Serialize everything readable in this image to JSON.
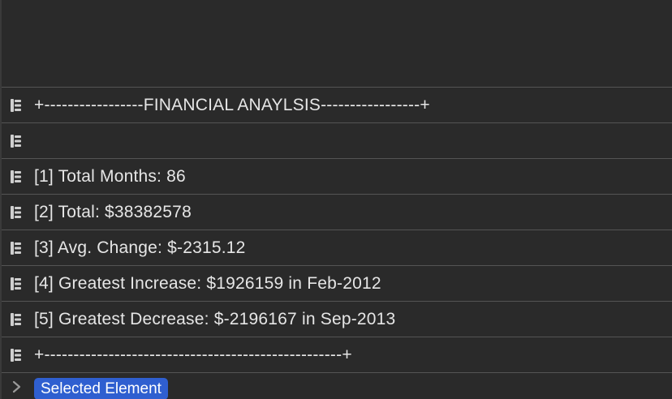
{
  "console": {
    "rows": [
      {
        "text": "+-----------------FINANCIAL ANAYLSIS-----------------+",
        "icon": "log-entry-icon"
      },
      {
        "text": "",
        "icon": "log-entry-icon"
      },
      {
        "text": "[1] Total Months: 86",
        "icon": "log-entry-icon"
      },
      {
        "text": "[2] Total: $38382578",
        "icon": "log-entry-icon"
      },
      {
        "text": "[3] Avg. Change: $-2315.12",
        "icon": "log-entry-icon"
      },
      {
        "text": "[4] Greatest Increase: $1926159 in Feb-2012",
        "icon": "log-entry-icon"
      },
      {
        "text": "[5] Greatest Decrease: $-2196167 in Sep-2013",
        "icon": "log-entry-icon"
      },
      {
        "text": "+---------------------------------------------------+",
        "icon": "log-entry-icon"
      }
    ],
    "prompt": {
      "badge_label": "Selected Element",
      "icon": "chevron-right-icon"
    }
  },
  "colors": {
    "background": "#2a2a2a",
    "divider": "#545454",
    "text": "#e6e6e6",
    "badge": "#2f5fd0"
  }
}
